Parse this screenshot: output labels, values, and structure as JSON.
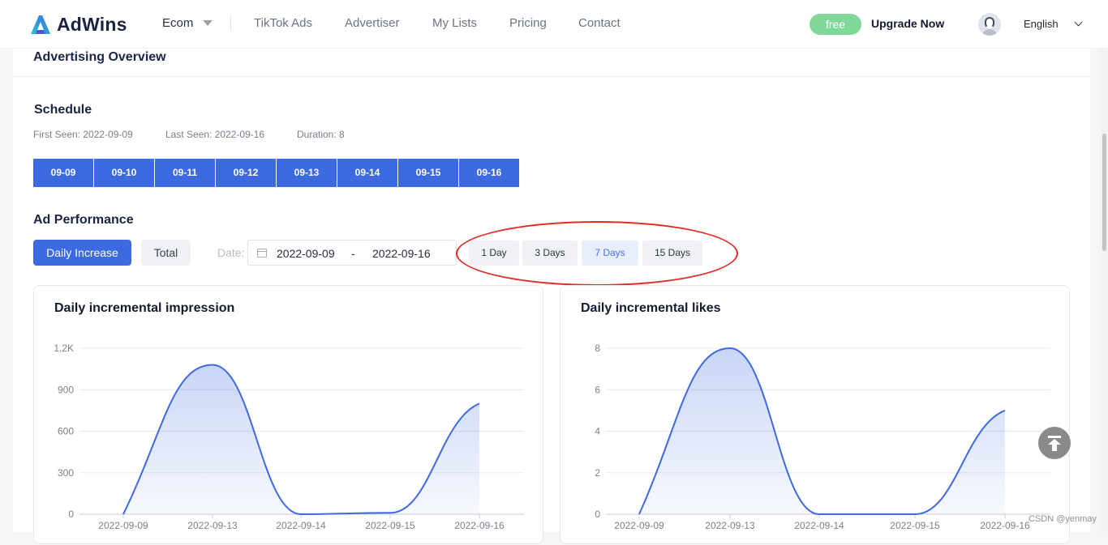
{
  "header": {
    "logo_text": "AdWins",
    "nav": [
      {
        "label": "Ecom"
      },
      {
        "label": "TikTok Ads"
      },
      {
        "label": "Advertiser"
      },
      {
        "label": "My Lists"
      },
      {
        "label": "Pricing"
      },
      {
        "label": "Contact"
      }
    ],
    "free_badge": "free",
    "upgrade_label": "Upgrade Now",
    "language": "English"
  },
  "overview": {
    "title": "Advertising Overview"
  },
  "schedule": {
    "title": "Schedule",
    "first_seen": "First Seen: 2022-09-09",
    "last_seen": "Last Seen: 2022-09-16",
    "duration": "Duration: 8",
    "days": [
      "09-09",
      "09-10",
      "09-11",
      "09-12",
      "09-13",
      "09-14",
      "09-15",
      "09-16"
    ]
  },
  "performance": {
    "title": "Ad Performance",
    "daily_increase_label": "Daily Increase",
    "total_label": "Total",
    "date_label": "Date:",
    "date_start": "2022-09-09",
    "date_separator": "-",
    "date_end": "2022-09-16",
    "ranges": [
      {
        "label": "1 Day",
        "active": false
      },
      {
        "label": "3 Days",
        "active": false
      },
      {
        "label": "7 Days",
        "active": true
      },
      {
        "label": "15 Days",
        "active": false
      }
    ]
  },
  "chart_data": [
    {
      "type": "area",
      "title": "Daily incremental impression",
      "x": [
        "2022-09-09",
        "2022-09-13",
        "2022-09-14",
        "2022-09-15",
        "2022-09-16"
      ],
      "values": [
        0,
        1080,
        0,
        10,
        800
      ],
      "yticks": [
        "0",
        "300",
        "600",
        "900",
        "1.2K"
      ],
      "ylim": [
        0,
        1200
      ],
      "grid": true,
      "color": "#3e6ae1"
    },
    {
      "type": "area",
      "title": "Daily incremental likes",
      "x": [
        "2022-09-09",
        "2022-09-13",
        "2022-09-14",
        "2022-09-15",
        "2022-09-16"
      ],
      "values": [
        0,
        8,
        0,
        0,
        5
      ],
      "yticks": [
        "0",
        "2",
        "4",
        "6",
        "8"
      ],
      "ylim": [
        0,
        8
      ],
      "grid": true,
      "color": "#3e6ae1"
    }
  ],
  "watermark": "CSDN @yenmay"
}
